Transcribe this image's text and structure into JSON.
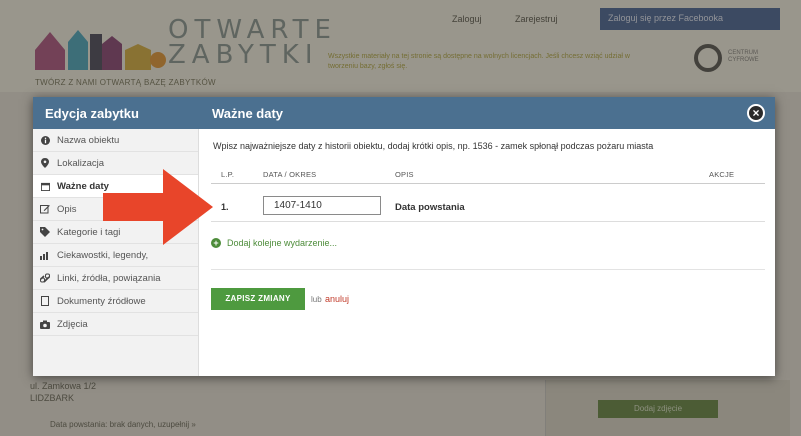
{
  "background": {
    "logo_line1": "OTWARTE",
    "logo_line2": "ZABYTKI",
    "tagline": "TWÓRZ Z NAMI OTWARTĄ BAZĘ ZABYTKÓW",
    "login": "Zaloguj",
    "register": "Zarejestruj",
    "facebook_login": "Zaloguj się przez Facebooka",
    "info_text": "Wszystkie materiały na tej stronie są dostępne na wolnych licencjach. Jeśli chcesz wziąć udział w tworzeniu bazy, zgłoś się.",
    "address": "ul. Zamkowa 1/2",
    "city": "LIDZBARK",
    "bottom_text": "Data powstania: brak danych, uzupełnij »",
    "right_button": "Dodaj zdjęcie"
  },
  "modal": {
    "left_title": "Edycja zabytku",
    "right_title": "Ważne daty",
    "close_icon": "close-icon"
  },
  "sidebar": {
    "items": [
      {
        "label": "Nazwa obiektu",
        "icon": "info-icon"
      },
      {
        "label": "Lokalizacja",
        "icon": "map-pin-icon"
      },
      {
        "label": "Ważne daty",
        "icon": "calendar-icon"
      },
      {
        "label": "Opis",
        "icon": "edit-icon"
      },
      {
        "label": "Kategorie i tagi",
        "icon": "tag-icon"
      },
      {
        "label": "Ciekawostki, legendy,",
        "icon": "chart-icon"
      },
      {
        "label": "Linki, źródła, powiązania",
        "icon": "link-icon"
      },
      {
        "label": "Dokumenty źródłowe",
        "icon": "document-icon"
      },
      {
        "label": "Zdjęcia",
        "icon": "camera-icon"
      }
    ]
  },
  "content": {
    "description": "Wpisz najważniejsze daty z historii obiektu, dodaj krótki opis, np. 1536 - zamek spłonął podczas pożaru miasta",
    "columns": {
      "lp": "L.P.",
      "date": "DATA / OKRES",
      "desc": "OPIS",
      "actions": "AKCJE"
    },
    "rows": [
      {
        "num": "1.",
        "date": "1407-1410",
        "desc": "Data powstania"
      }
    ],
    "add_event": "Dodaj kolejne wydarzenie...",
    "save_button": "ZAPISZ ZMIANY",
    "or": "lub",
    "cancel": "anuluj"
  },
  "colors": {
    "header_blue": "#4b7090",
    "save_green": "#4e9a3f",
    "arrow_red": "#e8452a",
    "cancel_red": "#c13b2a"
  }
}
